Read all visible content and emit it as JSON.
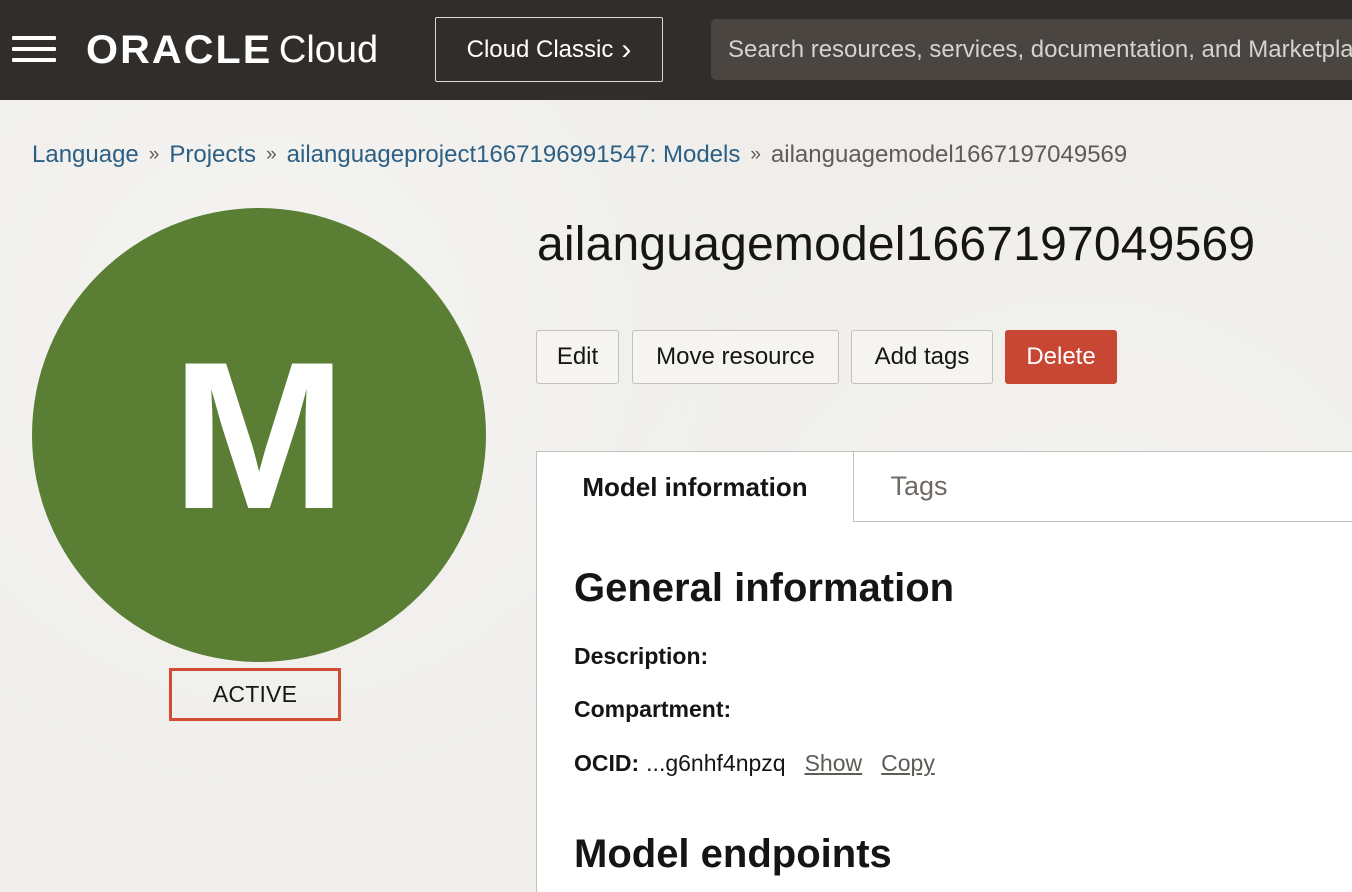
{
  "header": {
    "brand_oracle": "ORACLE",
    "brand_cloud": "Cloud",
    "classic_button": "Cloud Classic",
    "classic_chevron": "›",
    "search_placeholder": "Search resources, services, documentation, and Marketplace"
  },
  "breadcrumb": {
    "items": [
      {
        "label": "Language",
        "link": true
      },
      {
        "label": "Projects",
        "link": true
      },
      {
        "label": "ailanguageproject1667196991547: Models",
        "link": true
      },
      {
        "label": "ailanguagemodel1667197049569",
        "link": false
      }
    ],
    "separator": "»"
  },
  "resource": {
    "avatar_letter": "M",
    "status": "ACTIVE",
    "title": "ailanguagemodel1667197049569"
  },
  "actions": {
    "edit": "Edit",
    "move": "Move resource",
    "add_tags": "Add tags",
    "delete": "Delete"
  },
  "tabs": [
    {
      "label": "Model information",
      "active": true
    },
    {
      "label": "Tags",
      "active": false
    }
  ],
  "details": {
    "general_title": "General information",
    "description_label": "Description:",
    "compartment_label": "Compartment:",
    "ocid_label": "OCID:",
    "ocid_value": "...g6nhf4npzq",
    "show_link": "Show",
    "copy_link": "Copy",
    "endpoints_title": "Model endpoints"
  },
  "colors": {
    "topbar": "#312d2a",
    "avatar": "#5a7e33",
    "delete_button": "#c74634",
    "status_outline": "#d24b34",
    "breadcrumb_link": "#2c5f83"
  }
}
